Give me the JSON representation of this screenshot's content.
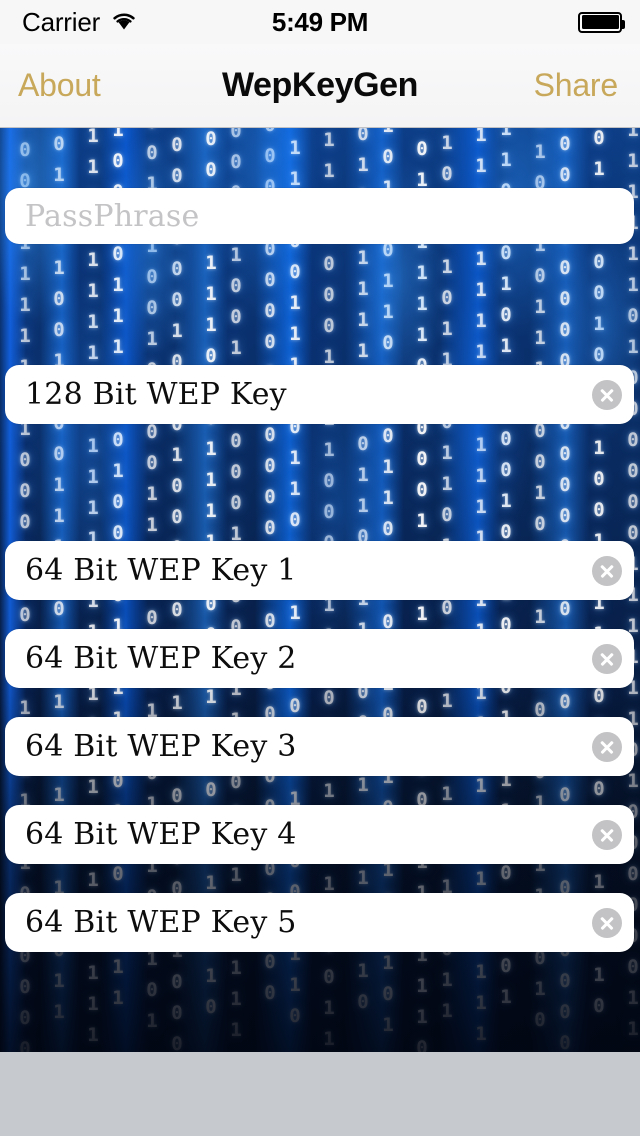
{
  "status_bar": {
    "carrier": "Carrier",
    "wifi_icon": "wifi-icon",
    "time": "5:49 PM",
    "battery_icon": "battery-full-icon"
  },
  "nav_bar": {
    "left_button": "About",
    "title": "WepKeyGen",
    "right_button": "Share",
    "tint_color": "#c8a85a",
    "background_color": "#f6f6f7"
  },
  "fields": [
    {
      "name": "passphrase",
      "value": "",
      "placeholder": "PassPhrase",
      "has_clear_button": false,
      "clear_icon": "clear-circle-x-icon"
    },
    {
      "name": "wep128",
      "value": "128 Bit WEP Key",
      "placeholder": "",
      "has_clear_button": true,
      "clear_icon": "clear-circle-x-icon"
    },
    {
      "name": "wep64-1",
      "value": "64 Bit WEP Key 1",
      "placeholder": "",
      "has_clear_button": true,
      "clear_icon": "clear-circle-x-icon"
    },
    {
      "name": "wep64-2",
      "value": "64 Bit WEP Key 2",
      "placeholder": "",
      "has_clear_button": true,
      "clear_icon": "clear-circle-x-icon"
    },
    {
      "name": "wep64-3",
      "value": "64 Bit WEP Key 3",
      "placeholder": "",
      "has_clear_button": true,
      "clear_icon": "clear-circle-x-icon"
    },
    {
      "name": "wep64-4",
      "value": "64 Bit WEP Key 4",
      "placeholder": "",
      "has_clear_button": true,
      "clear_icon": "clear-circle-x-icon"
    },
    {
      "name": "wep64-5",
      "value": "64 Bit WEP Key 5",
      "placeholder": "",
      "has_clear_button": true,
      "clear_icon": "clear-circle-x-icon"
    }
  ],
  "background": {
    "style": "binary-matrix-rain",
    "primary_color": "#0d3e86",
    "dark_color": "#04101f",
    "digit_color": "#ffffff",
    "columns": [
      "01101001011010",
      "1101001011",
      "011001101",
      "10110100110",
      "0001101011",
      "011010010110",
      "1011001",
      "0110100101",
      "110010110",
      "1001011010",
      "0110011",
      "1011010011",
      "010110100",
      "11010010110",
      "0101101",
      "100110101",
      "0110100",
      "11001011",
      "010011010",
      "1101001"
    ]
  },
  "bottom_bar": {
    "background_color": "#c6c9ce"
  }
}
